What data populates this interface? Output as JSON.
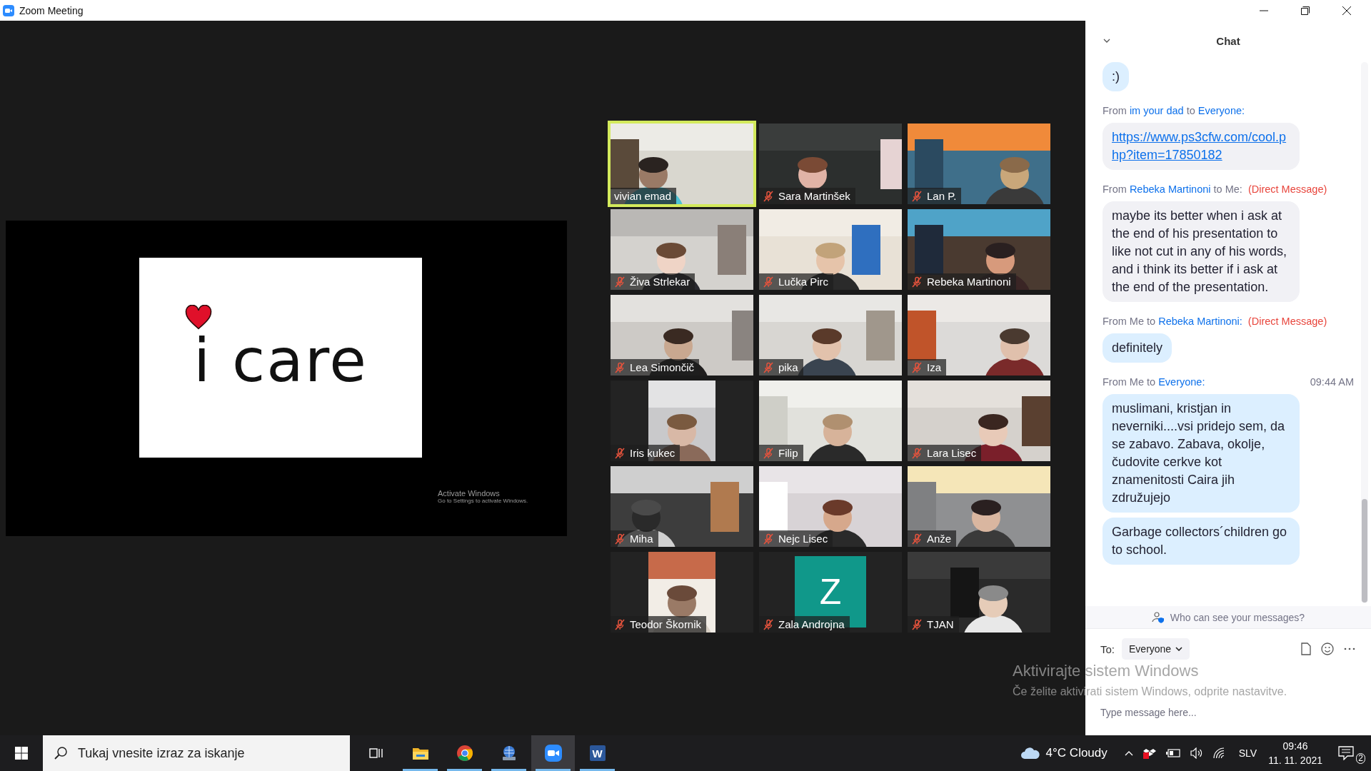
{
  "window": {
    "title": "Zoom Meeting"
  },
  "shared_screen": {
    "slide_text": "i care",
    "watermark": [
      "Activate Windows",
      "Go to Settings to activate Windows."
    ]
  },
  "participants": [
    {
      "name": "vivian emad",
      "kind": "video",
      "muted": false,
      "active_speaker": true
    },
    {
      "name": "Sara Martinšek",
      "kind": "video",
      "muted": true,
      "active_speaker": false
    },
    {
      "name": "Lan P.",
      "kind": "video",
      "muted": true,
      "active_speaker": false
    },
    {
      "name": "Živa Strlekar",
      "kind": "video",
      "muted": true,
      "active_speaker": false
    },
    {
      "name": "Lučka Pirc",
      "kind": "video",
      "muted": true,
      "active_speaker": false
    },
    {
      "name": "Rebeka Martinoni",
      "kind": "video",
      "muted": true,
      "active_speaker": false
    },
    {
      "name": "Lea Simončič",
      "kind": "video",
      "muted": true,
      "active_speaker": false
    },
    {
      "name": "pika",
      "kind": "video",
      "muted": true,
      "active_speaker": false
    },
    {
      "name": "Iza",
      "kind": "video",
      "muted": true,
      "active_speaker": false
    },
    {
      "name": "Iris kukec",
      "kind": "portrait",
      "muted": true,
      "active_speaker": false
    },
    {
      "name": "Filip",
      "kind": "video",
      "muted": true,
      "active_speaker": false
    },
    {
      "name": "Lara Lisec",
      "kind": "video",
      "muted": true,
      "active_speaker": false
    },
    {
      "name": "Miha",
      "kind": "video",
      "muted": true,
      "active_speaker": false
    },
    {
      "name": "Nejc Lisec",
      "kind": "video",
      "muted": true,
      "active_speaker": false
    },
    {
      "name": "Anže",
      "kind": "video",
      "muted": true,
      "active_speaker": false
    },
    {
      "name": "Teodor Škornik",
      "kind": "portrait",
      "muted": true,
      "active_speaker": false
    },
    {
      "name": "Zala Androjna",
      "kind": "avatar",
      "initial": "Z",
      "muted": true,
      "active_speaker": false
    },
    {
      "name": "TJAN",
      "kind": "video",
      "muted": true,
      "active_speaker": false
    }
  ],
  "chat": {
    "title": "Chat",
    "groups": [
      {
        "mine": true,
        "bubbles": [
          {
            "kind": "text",
            "text": ":)"
          }
        ]
      },
      {
        "mine": false,
        "header": [
          {
            "kind": "plain",
            "text": "From"
          },
          {
            "kind": "name",
            "text": "im your dad"
          },
          {
            "kind": "plain",
            "text": "to"
          },
          {
            "kind": "name",
            "text": "Everyone:"
          }
        ],
        "bubbles": [
          {
            "kind": "link",
            "text": "https://www.ps3cfw.com/cool.php?item=17850182"
          }
        ]
      },
      {
        "mine": false,
        "header": [
          {
            "kind": "plain",
            "text": "From"
          },
          {
            "kind": "name",
            "text": "Rebeka Martinoni"
          },
          {
            "kind": "plain",
            "text": "to Me:"
          },
          {
            "kind": "direct",
            "text": "(Direct Message)"
          }
        ],
        "bubbles": [
          {
            "kind": "text",
            "text": "maybe its better when i ask at the end of his presentation to like not cut in any of his words, and i think its better if i ask at the end of the presentation."
          }
        ]
      },
      {
        "mine": true,
        "header": [
          {
            "kind": "plain",
            "text": "From Me to"
          },
          {
            "kind": "name",
            "text": "Rebeka Martinoni:"
          },
          {
            "kind": "direct",
            "text": "(Direct Message)"
          }
        ],
        "bubbles": [
          {
            "kind": "text",
            "text": "definitely"
          }
        ]
      },
      {
        "mine": true,
        "header": [
          {
            "kind": "plain",
            "text": "From Me to"
          },
          {
            "kind": "name",
            "text": "Everyone:"
          }
        ],
        "time": "09:44 AM",
        "bubbles": [
          {
            "kind": "text",
            "text": "muslimani, kristjan in neverniki....vsi pridejo sem, da se zabavo. Zabava, okolje, čudovite cerkve kot znamenitosti Caira jih združujejo"
          },
          {
            "kind": "text",
            "text": "Garbage collectors´children go to school."
          }
        ]
      }
    ],
    "privacy_note": "Who can see your messages?",
    "to_label": "To:",
    "recipient": "Everyone",
    "placeholder": "Type message here..."
  },
  "os_watermark": [
    "Aktivirajte sistem Windows",
    "Če želite aktivirati sistem Windows, odprite nastavitve."
  ],
  "taskbar": {
    "search_placeholder": "Tukaj vnesite izraz za iskanje",
    "apps": [
      {
        "kind": "task_view",
        "running": false,
        "selected": false
      },
      {
        "kind": "folder",
        "running": true,
        "selected": false
      },
      {
        "kind": "browser",
        "running": true,
        "selected": false
      },
      {
        "kind": "globe",
        "running": true,
        "selected": false
      },
      {
        "kind": "camera",
        "running": true,
        "selected": true
      },
      {
        "kind": "document",
        "label": "W",
        "running": true,
        "selected": false
      }
    ],
    "weather": "4°C Cloudy",
    "language": "SLV",
    "time": "09:46",
    "date": "11. 11. 2021",
    "notification_count": "2"
  }
}
